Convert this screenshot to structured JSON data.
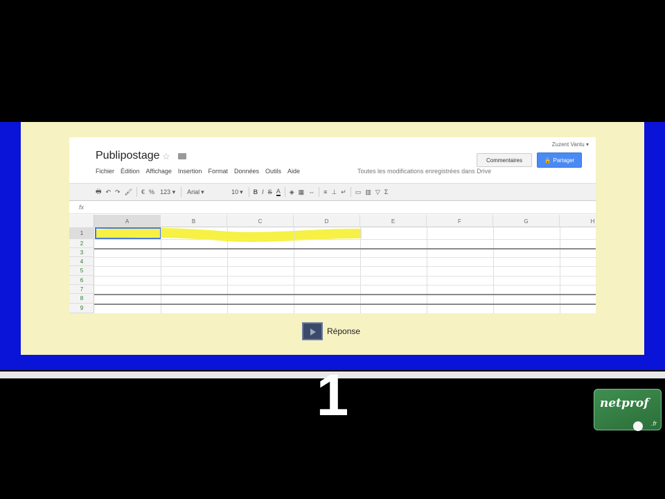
{
  "document": {
    "title": "Publipostage",
    "account": "Zuzent Vantu ▾",
    "comments_label": "Commentaires",
    "share_label": "Partager",
    "save_status": "Toutes les modifications enregistrées dans Drive"
  },
  "menu": [
    "Fichier",
    "Édition",
    "Affichage",
    "Insertion",
    "Format",
    "Données",
    "Outils",
    "Aide"
  ],
  "toolbar": {
    "zoom": "123 ▾",
    "font": "Arial",
    "font_size": "10",
    "bold": "B",
    "italic": "I",
    "strike": "S",
    "text_color": "A"
  },
  "formula_bar": {
    "fx": "fx"
  },
  "grid": {
    "columns": [
      "A",
      "B",
      "C",
      "D",
      "E",
      "F",
      "G",
      "H"
    ],
    "rows": [
      "1",
      "2",
      "3",
      "4",
      "5",
      "6",
      "7",
      "8",
      "9"
    ],
    "selected_column": "A",
    "selected_row": "1",
    "highlight_color": "#f6f03a"
  },
  "response": {
    "label": "Réponse"
  },
  "slide_number": "1",
  "logo": {
    "name": "netprof",
    "suffix": ".fr"
  },
  "colors": {
    "frame_blue": "#0a14d8",
    "panel_cream": "#f6f2c2",
    "share_blue": "#4a8af4",
    "logo_green": "#3f8f4f"
  }
}
